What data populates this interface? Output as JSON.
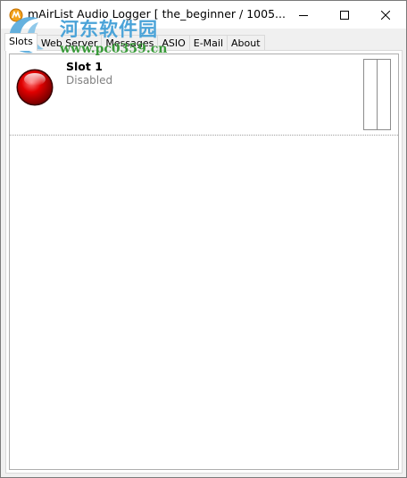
{
  "window": {
    "title": "mAirList Audio Logger [ the_beginner / 1005..."
  },
  "watermark": {
    "text": "河东软件园",
    "url": "www.pc0359.cn"
  },
  "tabs": [
    {
      "label": "Slots",
      "active": true
    },
    {
      "label": "Web Server",
      "active": false
    },
    {
      "label": "Messages",
      "active": false
    },
    {
      "label": "ASIO",
      "active": false
    },
    {
      "label": "E-Mail",
      "active": false
    },
    {
      "label": "About",
      "active": false
    }
  ],
  "slots": [
    {
      "name": "Slot 1",
      "status": "Disabled",
      "led_color": "#e00000"
    }
  ],
  "colors": {
    "led_red": "#e00000",
    "watermark_blue": "#4aa3d8",
    "watermark_green": "#3a9a3a"
  },
  "icons": {
    "app": "mairlist-logo-icon",
    "minimize": "minimize-icon",
    "maximize": "maximize-icon",
    "close": "close-icon",
    "led": "status-led-icon"
  }
}
